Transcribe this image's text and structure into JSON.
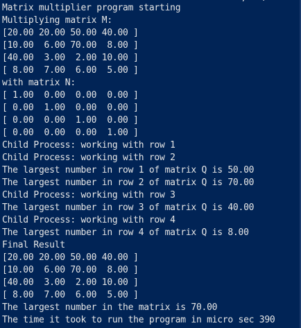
{
  "terminal": {
    "clipped_top_line": "                                       #    ,   /",
    "lines": [
      "Matrix multiplier program starting",
      "Multiplying matrix M:",
      "[20.00 20.00 50.00 40.00 ]",
      "[10.00  6.00 70.00  8.00 ]",
      "[40.00  3.00  2.00 10.00 ]",
      "[ 8.00  7.00  6.00  5.00 ]",
      "with matrix N:",
      "[ 1.00  0.00  0.00  0.00 ]",
      "[ 0.00  1.00  0.00  0.00 ]",
      "[ 0.00  0.00  1.00  0.00 ]",
      "[ 0.00  0.00  0.00  1.00 ]",
      "Child Process: working with row 1",
      "Child Process: working with row 2",
      "The largest number in row 1 of matrix Q is 50.00",
      "The largest number in row 2 of matrix Q is 70.00",
      "Child Process: working with row 3",
      "The largest number in row 3 of matrix Q is 40.00",
      "Child Process: working with row 4",
      "The largest number in row 4 of matrix Q is 8.00",
      "Final Result",
      "[20.00 20.00 50.00 40.00 ]",
      "[10.00  6.00 70.00  8.00 ]",
      "[40.00  3.00  2.00 10.00 ]",
      "[ 8.00  7.00  6.00  5.00 ]",
      "The largest number in the matrix is 70.00",
      "The time it took to run the program in micro sec 390"
    ]
  },
  "colors": {
    "background": "#012456",
    "foreground": "#e6e6e6"
  }
}
